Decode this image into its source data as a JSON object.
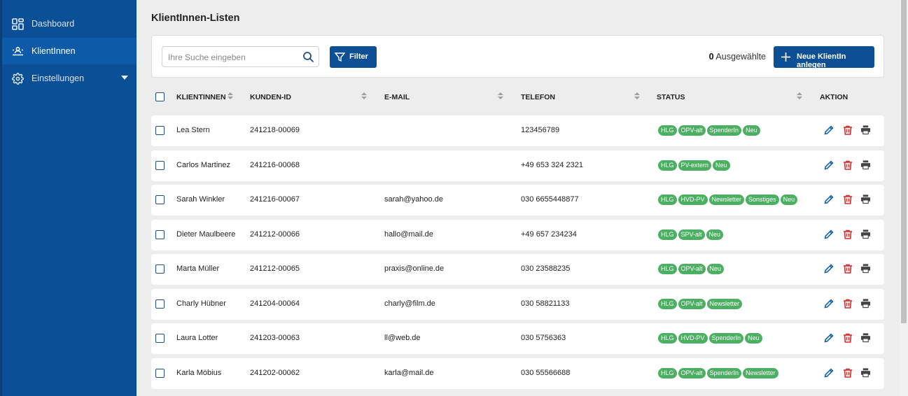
{
  "sidebar": {
    "items": [
      {
        "label": "Dashboard",
        "icon": "dashboard-icon"
      },
      {
        "label": "KlientInnen",
        "icon": "clients-icon"
      },
      {
        "label": "Einstellungen",
        "icon": "gear-icon"
      }
    ]
  },
  "page": {
    "title": "KlientInnen-Listen"
  },
  "toolbar": {
    "search_placeholder": "Ihre Suche eingeben",
    "filter_label": "Filter",
    "selected_count": "0",
    "selected_label": "Ausgewählte",
    "new_label": "Neue KlientIn anlegen"
  },
  "table": {
    "headers": [
      "KLIENTINNEN",
      "KUNDEN-ID",
      "E-MAIL",
      "TELEFON",
      "STATUS",
      "AKTION"
    ],
    "rows": [
      {
        "name": "Lea Stern",
        "id": "241218-00069",
        "email": "",
        "phone": "123456789",
        "tags": [
          "HLG",
          "OPV-alt",
          "SpenderIn",
          "Neu"
        ]
      },
      {
        "name": "Carlos Martinez",
        "id": "241216-00068",
        "email": "",
        "phone": "+49 653 324 2321",
        "tags": [
          "HLG",
          "PV-extern",
          "Neu"
        ]
      },
      {
        "name": "Sarah Winkler",
        "id": "241216-00067",
        "email": "sarah@yahoo.de",
        "phone": "030 6655448877",
        "tags": [
          "HLG",
          "HVD-PV",
          "Newsletter",
          "Sonstiges",
          "Neu"
        ]
      },
      {
        "name": "Dieter Maulbeere",
        "id": "241212-00066",
        "email": "hallo@mail.de",
        "phone": "+49 657 234234",
        "tags": [
          "HLG",
          "SPV-alt",
          "Neu"
        ]
      },
      {
        "name": "Marta Müller",
        "id": "241212-00065",
        "email": "praxis@online.de",
        "phone": "030 23588235",
        "tags": [
          "HLG",
          "OPV-alt",
          "Neu"
        ]
      },
      {
        "name": "Charly Hübner",
        "id": "241204-00064",
        "email": "charly@film.de",
        "phone": "030 58821133",
        "tags": [
          "HLG",
          "OPV-alt",
          "Newsletter"
        ]
      },
      {
        "name": "Laura Lotter",
        "id": "241203-00063",
        "email": "ll@web.de",
        "phone": "030 5756363",
        "tags": [
          "HLG",
          "HVD-PV",
          "SpenderIn",
          "Neu"
        ]
      },
      {
        "name": "Karla Möbius",
        "id": "241202-00062",
        "email": "karla@mail.de",
        "phone": "030 55566688",
        "tags": [
          "HLG",
          "OPV-alt",
          "SpenderIn",
          "Newsletter"
        ]
      }
    ]
  },
  "colors": {
    "sidebar": "#0b4f96",
    "accent": "#0d4f95",
    "tag": "#4caf62",
    "delete": "#d32f2f",
    "edit": "#1565a6"
  }
}
